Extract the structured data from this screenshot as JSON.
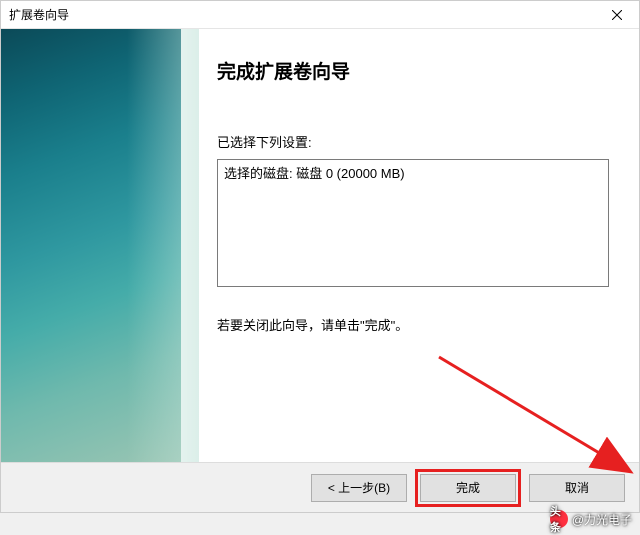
{
  "window": {
    "title": "扩展卷向导"
  },
  "content": {
    "heading": "完成扩展卷向导",
    "settings_label": "已选择下列设置:",
    "settings_line": "选择的磁盘: 磁盘 0 (20000 MB)",
    "close_hint": "若要关闭此向导，请单击\"完成\"。"
  },
  "buttons": {
    "back": "< 上一步(B)",
    "finish": "完成",
    "cancel": "取消"
  },
  "watermark": {
    "icon_text": "头条",
    "text": "@力光电子"
  }
}
